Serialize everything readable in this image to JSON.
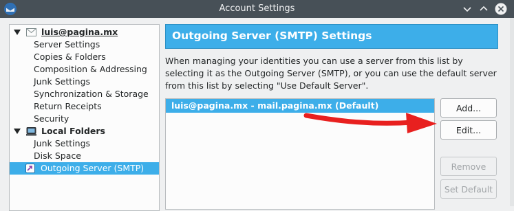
{
  "window": {
    "title": "Account Settings"
  },
  "tree": {
    "account": {
      "name": "luis@pagina.mx"
    },
    "account_items": [
      "Server Settings",
      "Copies & Folders",
      "Composition & Addressing",
      "Junk Settings",
      "Synchronization & Storage",
      "Return Receipts",
      "Security"
    ],
    "local_folders": {
      "name": "Local Folders"
    },
    "local_items": [
      "Junk Settings",
      "Disk Space"
    ],
    "outgoing": {
      "label": "Outgoing Server (SMTP)"
    }
  },
  "panel": {
    "heading": "Outgoing Server (SMTP) Settings",
    "description": "When managing your identities you can use a server from this list by selecting it as the Outgoing Server (SMTP), or you can use the default server from this list by selecting \"Use Default Server\".",
    "servers": [
      "luis@pagina.mx - mail.pagina.mx (Default)"
    ],
    "buttons": {
      "add": "Add...",
      "edit": "Edit...",
      "remove": "Remove",
      "set_default": "Set Default"
    }
  },
  "colors": {
    "accent": "#3daee9",
    "titlebar": "#475057",
    "annotation_arrow": "#e8201f"
  }
}
